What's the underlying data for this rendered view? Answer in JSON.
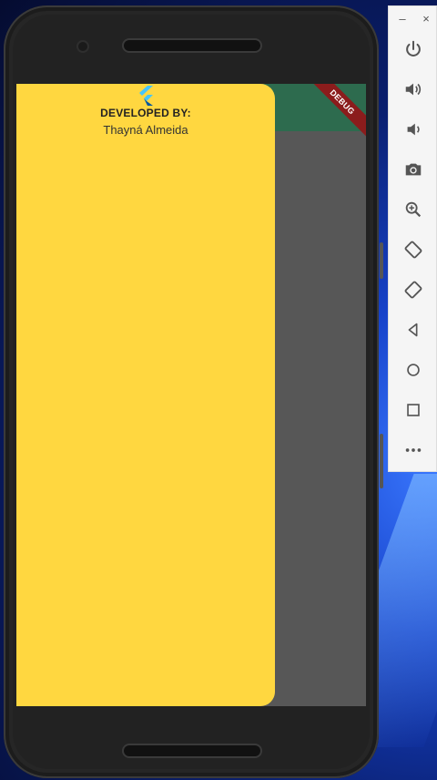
{
  "drawer": {
    "title": "DEVELOPED BY:",
    "author": "Thayná Almeida"
  },
  "debug_banner": "DEBUG",
  "emulator_toolbar": {
    "minimize": "–",
    "close": "×",
    "buttons": [
      "power-icon",
      "volume-up-icon",
      "volume-down-icon",
      "camera-icon",
      "zoom-icon",
      "rotate-left-icon",
      "rotate-right-icon",
      "back-icon",
      "home-icon",
      "overview-icon",
      "more-icon"
    ]
  },
  "colors": {
    "drawer_bg": "#ffd740",
    "appbar_bg": "#2d6b4e",
    "scrim_bg": "#575757",
    "debug_bg": "#8b1c1c"
  }
}
